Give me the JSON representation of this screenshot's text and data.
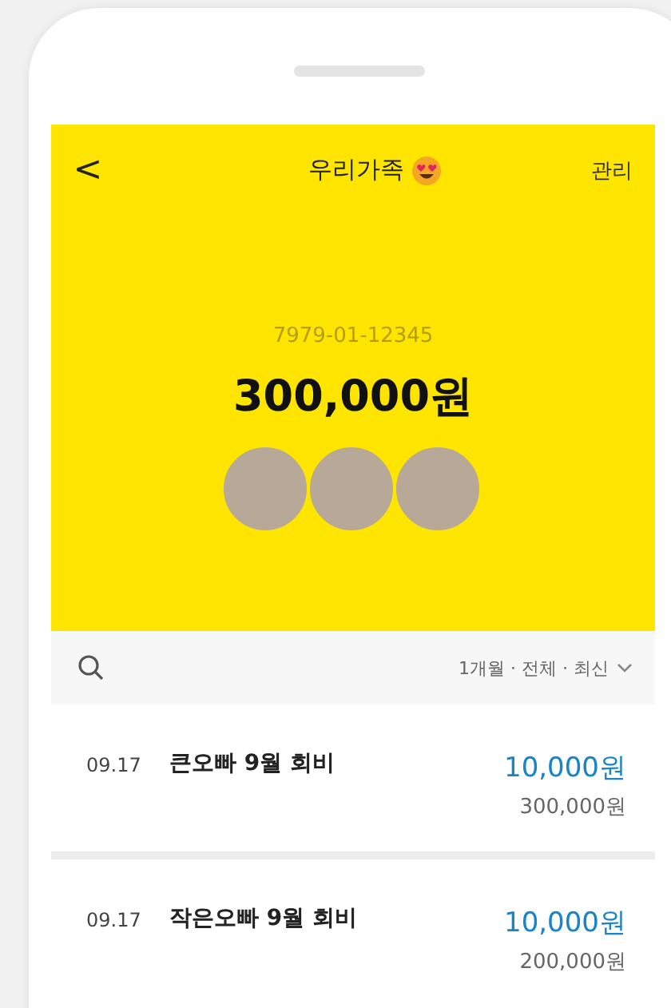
{
  "header": {
    "back": "<",
    "title": "우리가족",
    "action": "관리"
  },
  "account": {
    "number": "7979-01-12345",
    "balance": "300,000원"
  },
  "members": [
    {
      "kind": "photo"
    },
    {
      "kind": "photo"
    },
    {
      "kind": "photo"
    }
  ],
  "filter": {
    "label": "1개월 · 전체 · 최신"
  },
  "transactions": [
    {
      "date": "09.17",
      "title": "큰오빠 9월 회비",
      "amount": "10,000원",
      "balance": "300,000원"
    },
    {
      "date": "09.17",
      "title": "작은오빠 9월 회비",
      "amount": "10,000원",
      "balance": "200,000원"
    }
  ]
}
